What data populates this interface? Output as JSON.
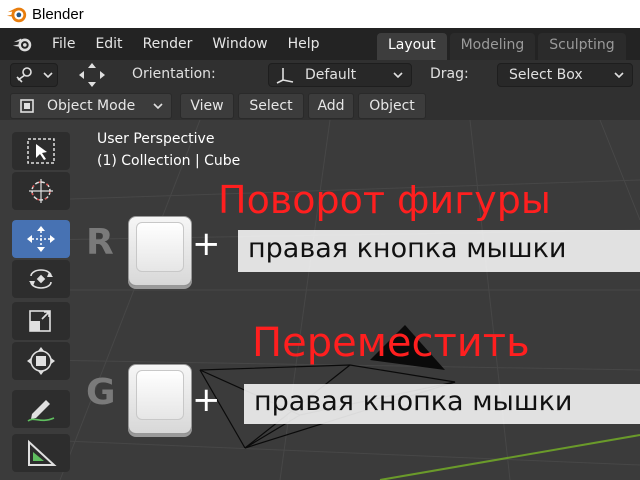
{
  "window": {
    "title": "Blender"
  },
  "menu": {
    "items": [
      "File",
      "Edit",
      "Render",
      "Window",
      "Help"
    ]
  },
  "workspace_tabs": [
    {
      "label": "Layout",
      "active": true
    },
    {
      "label": "Modeling",
      "active": false
    },
    {
      "label": "Sculpting",
      "active": false
    }
  ],
  "header": {
    "orientation_label": "Orientation:",
    "orientation_value": "Default",
    "drag_label": "Drag:",
    "drag_value": "Select Box"
  },
  "header2": {
    "mode": "Object Mode",
    "buttons": [
      "View",
      "Select",
      "Add",
      "Object"
    ]
  },
  "viewport": {
    "perspective": "User Perspective",
    "collection": "(1) Collection | Cube"
  },
  "overlay": {
    "rotate_title": "Поворот фигуры",
    "rotate_key": "R",
    "rotate_plus": "+",
    "rotate_hint": "правая кнопка мышки",
    "move_title": "Переместить",
    "move_key": "G",
    "move_plus": "+",
    "move_hint": "правая кнопка мышки"
  },
  "colors": {
    "accent": "#4772b3",
    "overlay_red": "#ff1f1f",
    "blender_orange": "#e87d0d"
  }
}
